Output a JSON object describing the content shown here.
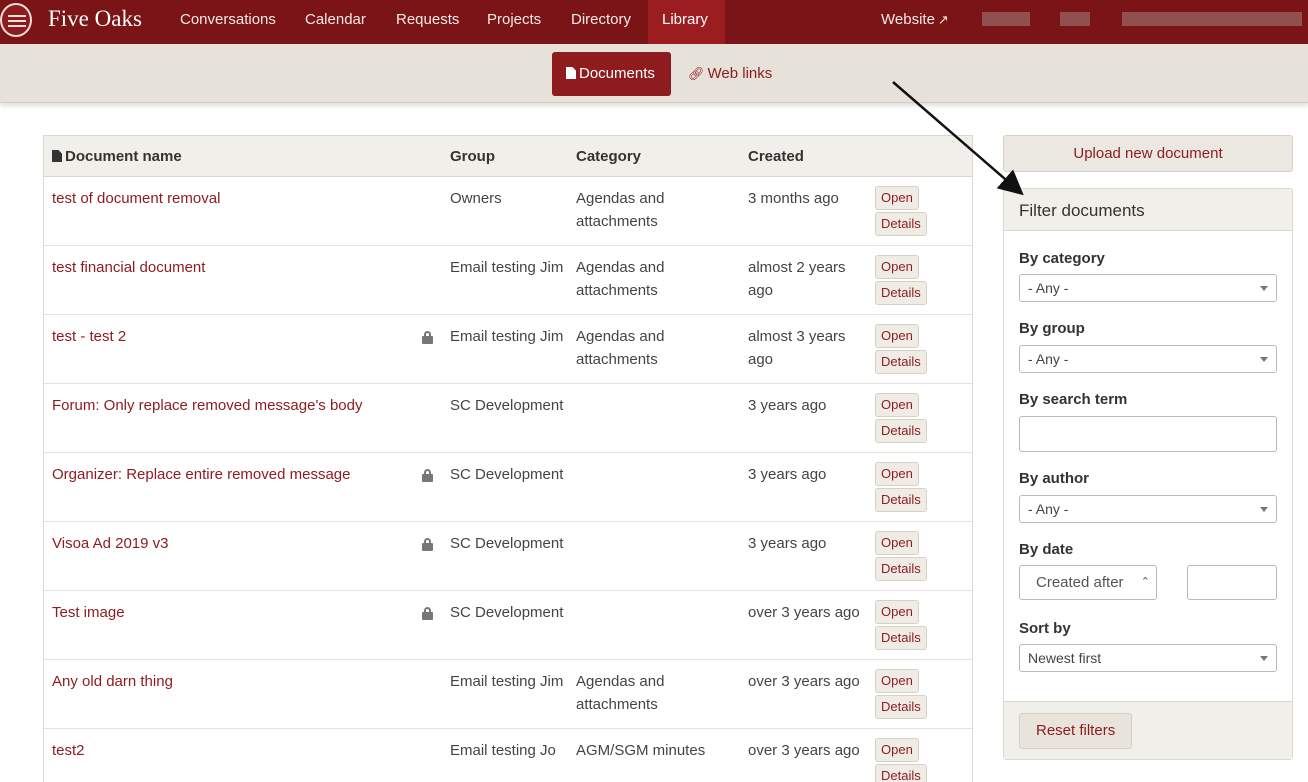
{
  "topnav": {
    "brand": "Five Oaks",
    "items": [
      "Conversations",
      "Calendar",
      "Requests",
      "Projects",
      "Directory",
      "Library"
    ],
    "active": "Library",
    "website": "Website"
  },
  "subnav": {
    "documents": "Documents",
    "weblinks": "Web links"
  },
  "table": {
    "headers": {
      "name": "Document name",
      "group": "Group",
      "category": "Category",
      "created": "Created"
    },
    "open_label": "Open",
    "details_label": "Details",
    "rows": [
      {
        "name": "test of document removal",
        "locked": false,
        "group": "Owners",
        "category": "Agendas and attachments",
        "created": "3 months ago"
      },
      {
        "name": "test financial document",
        "locked": false,
        "group": "Email testing Jim",
        "category": "Agendas and attachments",
        "created": "almost 2 years ago"
      },
      {
        "name": "test - test 2",
        "locked": true,
        "group": "Email testing Jim",
        "category": "Agendas and attachments",
        "created": "almost 3 years ago"
      },
      {
        "name": "Forum: Only replace removed message's body",
        "locked": false,
        "group": "SC Development",
        "category": "",
        "created": "3 years ago"
      },
      {
        "name": "Organizer: Replace entire removed message",
        "locked": true,
        "group": "SC Development",
        "category": "",
        "created": "3 years ago"
      },
      {
        "name": "Visoa Ad 2019 v3",
        "locked": true,
        "group": "SC Development",
        "category": "",
        "created": "3 years ago"
      },
      {
        "name": "Test image",
        "locked": true,
        "group": "SC Development",
        "category": "",
        "created": "over 3 years ago"
      },
      {
        "name": "Any old darn thing",
        "locked": false,
        "group": "Email testing Jim",
        "category": "Agendas and attachments",
        "created": "over 3 years ago"
      },
      {
        "name": "test2",
        "locked": false,
        "group": "Email testing Jo",
        "category": "AGM/SGM minutes",
        "created": "over 3 years ago"
      }
    ]
  },
  "sidebar": {
    "upload": "Upload new document",
    "filter_title": "Filter documents",
    "by_category": "By category",
    "category_value": "- Any -",
    "by_group": "By group",
    "group_value": "- Any -",
    "by_search": "By search term",
    "by_author": "By author",
    "author_value": "- Any -",
    "by_date": "By date",
    "date_mode": "Created after",
    "sort_by": "Sort by",
    "sort_value": "Newest first",
    "reset": "Reset filters"
  },
  "colors": {
    "brand": "#7a1416",
    "accent": "#8e1b1e",
    "subbar": "#e6e2d9"
  }
}
